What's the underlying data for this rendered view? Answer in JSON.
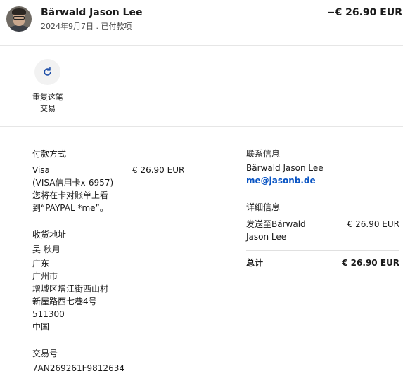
{
  "header": {
    "name": "Bärwald Jason Lee",
    "date_status": "2024年9月7日 . 已付款项",
    "amount": "−€ 26.90 EUR"
  },
  "actions": {
    "repeat_label": "重复这笔交易"
  },
  "payment": {
    "heading": "付款方式",
    "method_lines": [
      "Visa",
      "(VISA信用卡x-6957)",
      "您将在卡对账单上看",
      "到“PAYPAL *me”。"
    ],
    "amount": "€ 26.90 EUR"
  },
  "shipping": {
    "heading": "收货地址",
    "lines": [
      "吴 秋月",
      "广东",
      "广州市",
      "增城区增江街西山村",
      "新屋路西七巷4号",
      "511300",
      "中国"
    ]
  },
  "transaction": {
    "heading": "交易号",
    "id": "7AN269261F9812634"
  },
  "contact": {
    "heading": "联系信息",
    "name": "Bärwald Jason Lee",
    "email": "me@jasonb.de"
  },
  "details": {
    "heading": "详细信息",
    "ship_to_lines": [
      "发送至Bärwald",
      "Jason Lee"
    ],
    "ship_amount": "€ 26.90 EUR",
    "total_label": "总计",
    "total_amount": "€ 26.90 EUR"
  },
  "icons": [
    "repeat-icon",
    "avatar"
  ],
  "colors": {
    "link": "#0a55c4",
    "divider": "#e6e6e6"
  }
}
